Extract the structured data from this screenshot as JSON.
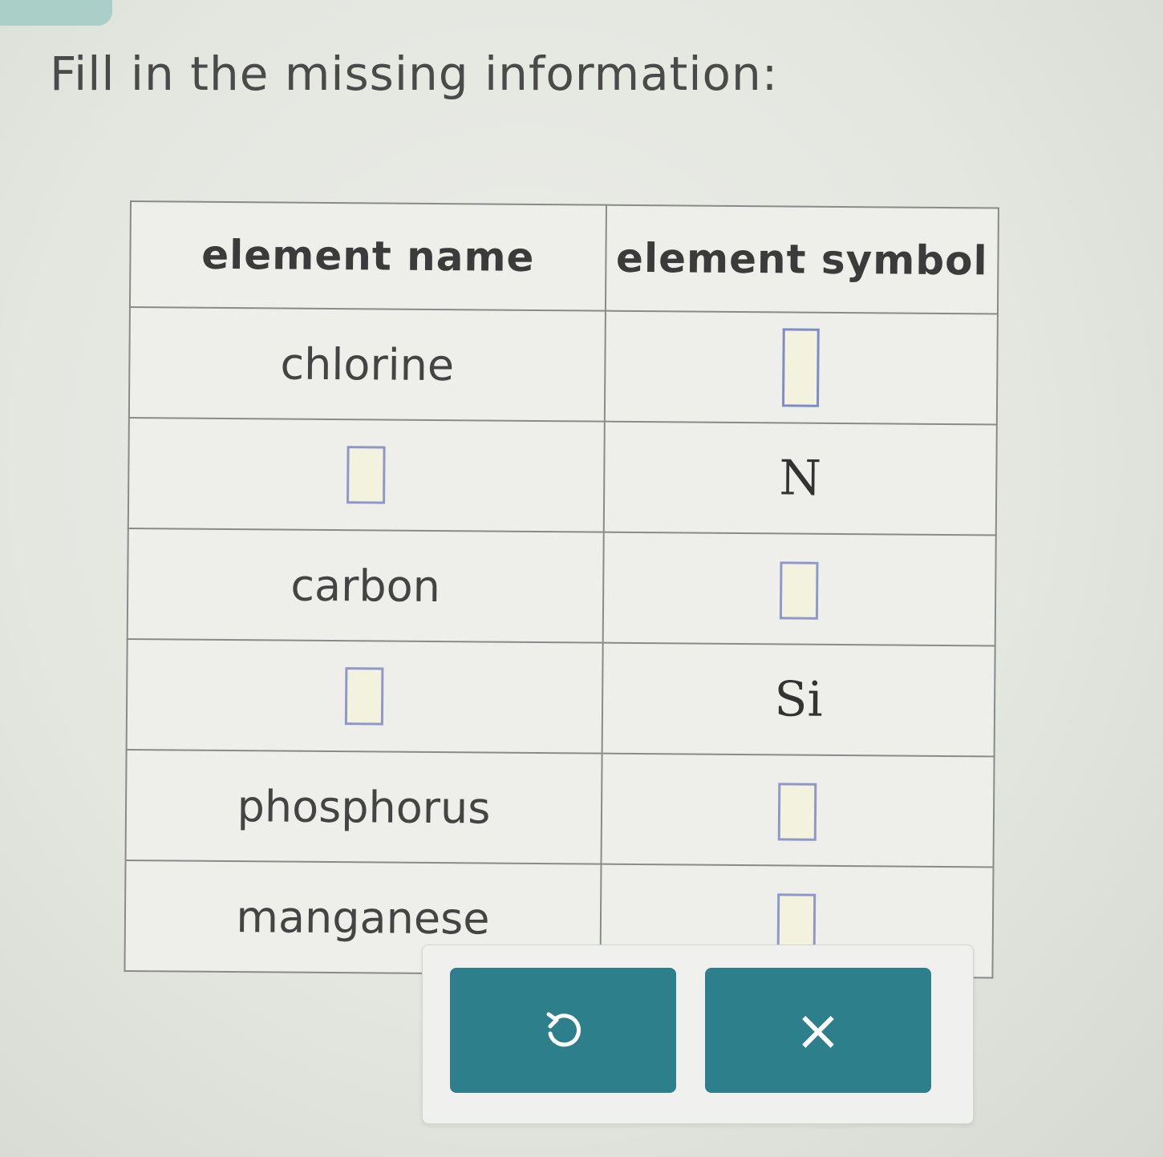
{
  "page": {
    "prompt": "Fill in the missing information:"
  },
  "table": {
    "headers": {
      "name": "element name",
      "symbol": "element symbol"
    },
    "rows": [
      {
        "name": "chlorine",
        "symbol": ""
      },
      {
        "name": "",
        "symbol": "N"
      },
      {
        "name": "carbon",
        "symbol": ""
      },
      {
        "name": "",
        "symbol": "Si"
      },
      {
        "name": "phosphorus",
        "symbol": ""
      },
      {
        "name": "manganese",
        "symbol": ""
      }
    ]
  },
  "actions": {
    "undo_icon": "undo-icon",
    "clear_label": "×"
  },
  "colors": {
    "button": "#2e7f8c",
    "input_border": "#8f98c8",
    "input_fill": "#f3f2df"
  }
}
